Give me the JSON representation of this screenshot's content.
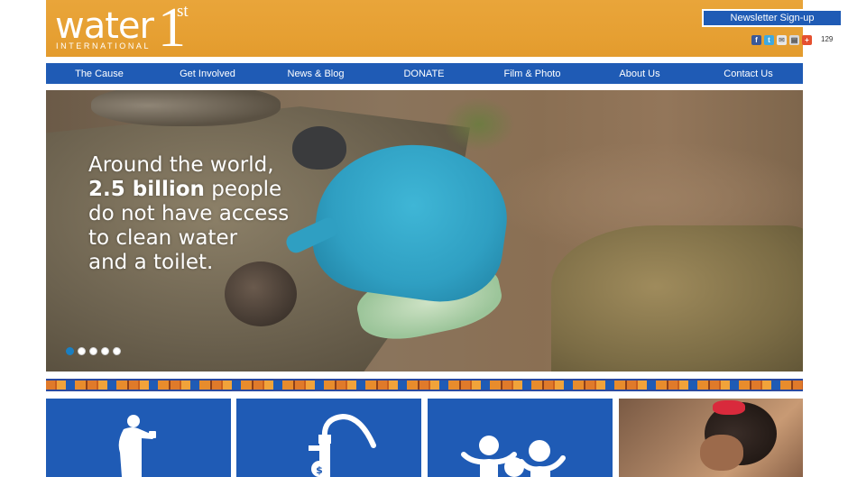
{
  "header": {
    "logo": {
      "word": "water",
      "number": "1",
      "superscript": "st",
      "tagline": "INTERNATIONAL"
    },
    "newsletter_label": "Newsletter Sign-up",
    "share_count": "129"
  },
  "nav": {
    "items": [
      "The Cause",
      "Get Involved",
      "News & Blog",
      "DONATE",
      "Film & Photo",
      "About Us",
      "Contact Us"
    ]
  },
  "hero": {
    "line1": "Around the world,",
    "line2_bold": "2.5 billion",
    "line2_rest": " people",
    "line3": "do not have access",
    "line4": "to clean water",
    "line5": "and a toilet.",
    "slides_total": 5,
    "slide_active": 1
  },
  "colors": {
    "brand_orange": "#e6a033",
    "brand_blue": "#1f5bb5",
    "dot_active": "#1b7fc1"
  },
  "tiles": [
    {
      "icon": "person-drinking-icon"
    },
    {
      "icon": "water-pump-icon"
    },
    {
      "icon": "community-people-icon"
    },
    {
      "icon": "photo-girl"
    }
  ]
}
